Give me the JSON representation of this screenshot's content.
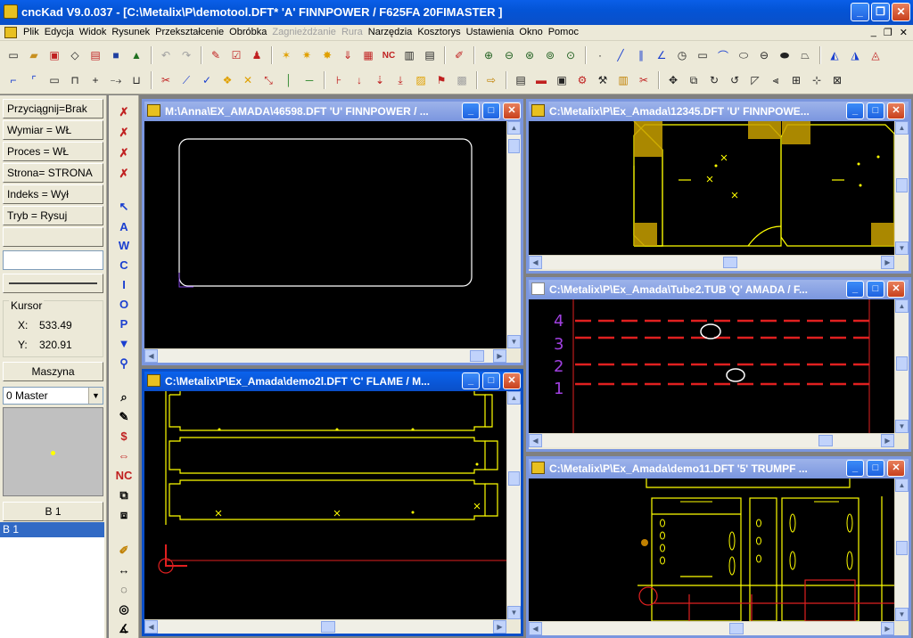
{
  "window": {
    "title": "cncKad V9.0.037 - [C:\\Metalix\\P\\demotool.DFT*  'A'  FINNPOWER / F625FA     20FIMASTER  ]",
    "min_label": "_",
    "max_label": "❐",
    "close_label": "✕"
  },
  "menu": {
    "items": [
      "Plik",
      "Edycja",
      "Widok",
      "Rysunek",
      "Przekształcenie",
      "Obróbka",
      "Zagnieżdżanie",
      "Rura",
      "Narzędzia",
      "Kosztorys",
      "Ustawienia",
      "Okno",
      "Pomoc"
    ],
    "disabled": [
      "Zagnieżdżanie",
      "Rura"
    ],
    "mdi_controls": [
      "_",
      "❐",
      "✕"
    ]
  },
  "left_panel": {
    "buttons": [
      "Przyciągnij=Brak",
      "Wymiar = WŁ",
      "Proces = WŁ",
      "Strona= STRONA",
      "Indeks = Wył",
      "Tryb = Rysuj"
    ],
    "cursor_legend": "Kursor",
    "cursor_x_label": "X:",
    "cursor_x": "533.49",
    "cursor_y_label": "Y:",
    "cursor_y": "320.91",
    "machine_button": "Maszyna",
    "machine_select": "0 Master",
    "sheet_button": "B 1",
    "sheet_list": [
      "B 1"
    ]
  },
  "vertical_tools": {
    "letters": [
      "A",
      "W",
      "C",
      "I",
      "O",
      "P"
    ]
  },
  "child_windows": [
    {
      "id": "w1",
      "title": "M:\\Anna\\EX_AMADA\\46598.DFT  'U'  FINNPOWER / ...",
      "active": false
    },
    {
      "id": "w2",
      "title": "C:\\Metalix\\P\\Ex_Amada\\12345.DFT  'U'  FINNPOWE...",
      "active": false
    },
    {
      "id": "w3",
      "title": "C:\\Metalix\\P\\Ex_Amada\\Tube2.TUB  'Q'  AMADA / F...",
      "active": false
    },
    {
      "id": "w4",
      "title": "C:\\Metalix\\P\\Ex_Amada\\demo2l.DFT  'C'  FLAME / M...",
      "active": true
    },
    {
      "id": "w5",
      "title": "C:\\Metalix\\P\\Ex_Amada\\demo11.DFT  '5'  TRUMPF ...",
      "active": false
    }
  ],
  "tube_labels": [
    "4",
    "3",
    "2",
    "1"
  ],
  "colors": {
    "titlebar": "#0a4fc8",
    "canvas": "#000000",
    "part_yellow": "#ffff00",
    "tube_red": "#e02020",
    "tube_label": "#a040e0",
    "selection": "#316ac5"
  }
}
